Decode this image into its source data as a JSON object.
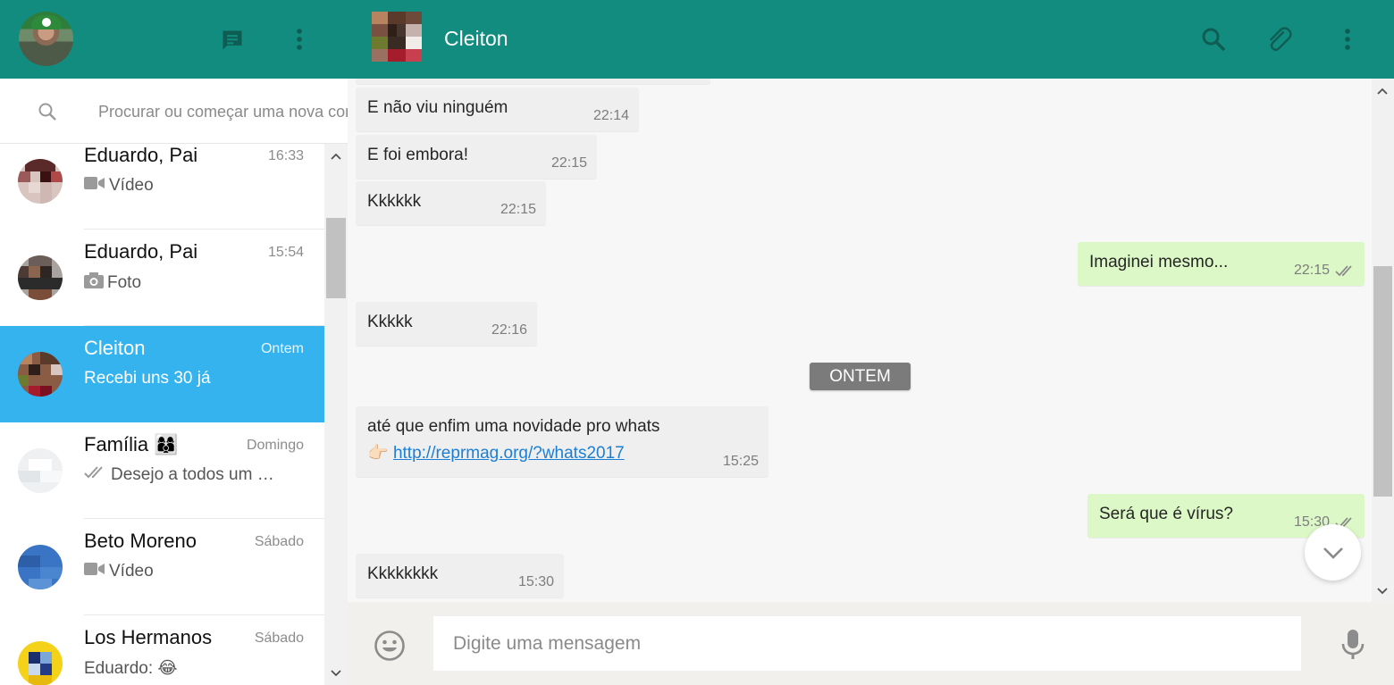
{
  "app": {
    "accent_color": "#128c7e",
    "active_chat_color": "#34b3ef"
  },
  "search": {
    "placeholder": "Procurar ou começar uma nova conversa"
  },
  "chats": [
    {
      "name": "Eduardo, Pai",
      "time": "16:33",
      "preview": "Vídeo",
      "preview_icon": "video-icon"
    },
    {
      "name": "Eduardo, Pai",
      "time": "15:54",
      "preview": "Foto",
      "preview_icon": "camera-icon"
    },
    {
      "name": "Cleiton",
      "time": "Ontem",
      "preview": "Recebi uns 30 já",
      "active": true
    },
    {
      "name": "Família 👩‍👩‍👦",
      "time": "Domingo",
      "preview": "Desejo a todos um …",
      "preview_icon": "double-check-icon"
    },
    {
      "name": "Beto Moreno",
      "time": "Sábado",
      "preview": "Vídeo",
      "preview_icon": "video-icon"
    },
    {
      "name": "Los Hermanos",
      "time": "Sábado",
      "preview": "Eduardo: 😂"
    }
  ],
  "conversation": {
    "contact_name": "Cleiton",
    "messages": [
      {
        "direction": "in",
        "text": "E não viu ninguém",
        "time": "22:14"
      },
      {
        "direction": "in",
        "text": "E foi embora!",
        "time": "22:15"
      },
      {
        "direction": "in",
        "text": "Kkkkkk",
        "time": "22:15"
      },
      {
        "direction": "out",
        "text": "Imaginei mesmo...",
        "time": "22:15"
      },
      {
        "direction": "in",
        "text": "Kkkkk",
        "time": "22:16"
      },
      {
        "direction": "in",
        "text": "até que enfim uma novidade pro whats",
        "link_emoji": "👉🏻",
        "link": "http://reprmag.org/?whats2017",
        "time": "15:25"
      },
      {
        "direction": "out",
        "text": "Será que é vírus?",
        "time": "15:30"
      },
      {
        "direction": "in",
        "text": "Kkkkkkkk",
        "time": "15:30"
      }
    ],
    "day_divider": "ONTEM"
  },
  "composer": {
    "placeholder": "Digite uma mensagem"
  }
}
